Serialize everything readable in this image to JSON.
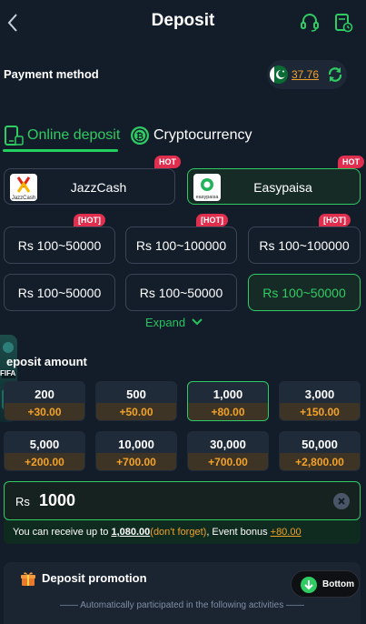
{
  "header": {
    "title": "Deposit",
    "back_icon": "chevron-left-icon",
    "support_icon": "headset-icon",
    "history_icon": "history-document-icon"
  },
  "payment_method": {
    "label": "Payment method",
    "balance": "37.76",
    "currency_flag": "pakistan-flag-icon"
  },
  "tabs": [
    {
      "label": "Online deposit",
      "icon": "mobile-phone-icon",
      "active": true
    },
    {
      "label": "Cryptocurrency",
      "icon": "crypto-coin-icon",
      "active": false
    }
  ],
  "methods": [
    {
      "name": "JazzCash",
      "logo_text": "JazzCash",
      "badge": "HOT",
      "selected": false
    },
    {
      "name": "Easypaisa",
      "logo_text": "easypaisa",
      "badge": "HOT",
      "selected": true
    }
  ],
  "channels": [
    {
      "label": "Rs 100~50000",
      "badge": "[HOT]",
      "selected": false
    },
    {
      "label": "Rs 100~100000",
      "badge": "[HOT]",
      "selected": false
    },
    {
      "label": "Rs 100~100000",
      "badge": "[HOT]",
      "selected": false
    },
    {
      "label": "Rs 100~50000",
      "badge": "",
      "selected": false
    },
    {
      "label": "Rs 100~50000",
      "badge": "",
      "selected": false
    },
    {
      "label": "Rs 100~50000",
      "badge": "",
      "selected": true
    }
  ],
  "expand_label": "Expand",
  "side_banner": {
    "text": "FIFA"
  },
  "deposit_amount_label": "eposit amount",
  "amounts": [
    {
      "value": "200",
      "bonus": "+30.00",
      "selected": false
    },
    {
      "value": "500",
      "bonus": "+50.00",
      "selected": false
    },
    {
      "value": "1,000",
      "bonus": "+80.00",
      "selected": true
    },
    {
      "value": "3,000",
      "bonus": "+150.00",
      "selected": false
    },
    {
      "value": "5,000",
      "bonus": "+200.00",
      "selected": false
    },
    {
      "value": "10,000",
      "bonus": "+700.00",
      "selected": false
    },
    {
      "value": "30,000",
      "bonus": "+700.00",
      "selected": false
    },
    {
      "value": "50,000",
      "bonus": "+2,800.00",
      "selected": false
    }
  ],
  "input": {
    "currency": "Rs",
    "value": "1000"
  },
  "receive": {
    "prefix": "You can receive up to ",
    "amount": "1,080.00",
    "note": "(don't forget)",
    "mid": ", Event bonus ",
    "bonus": "+80.00"
  },
  "promotion": {
    "title": "Deposit promotion",
    "subtitle": "Automatically participated in the following activities"
  },
  "bottom_button": {
    "label": "Bottom"
  },
  "colors": {
    "accent": "#2fcb63",
    "bonus": "#f2a229",
    "hot": "#e02e4f",
    "background": "#131d2a"
  }
}
